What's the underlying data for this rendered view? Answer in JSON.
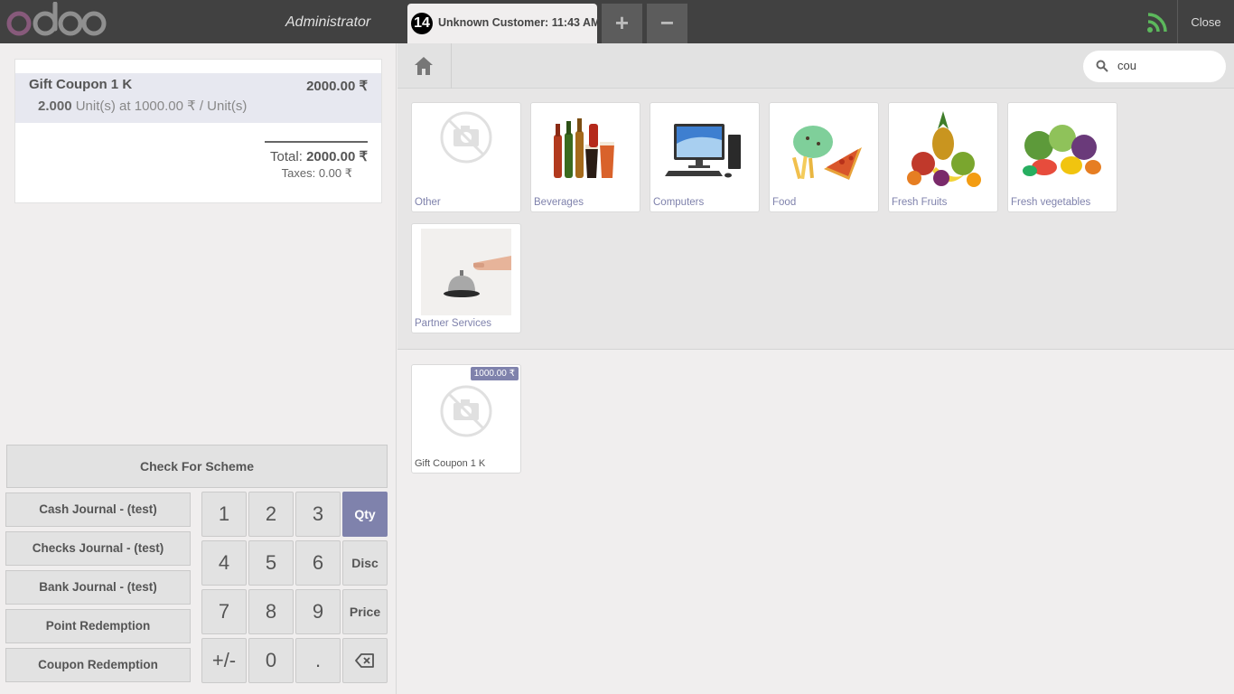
{
  "brand": {
    "name": "odoo"
  },
  "header": {
    "user": "Administrator",
    "order_tab": {
      "number": "14",
      "label": "Unknown Customer: 11:43 AM"
    },
    "add_order_symbol": "+",
    "remove_order_symbol": "−",
    "close_label": "Close",
    "connection_status_icon": "wifi-icon",
    "connection_color": "#5cb85c"
  },
  "order": {
    "lines": [
      {
        "name": "Gift Coupon 1 K",
        "price": "2000.00 ₹",
        "qty": "2.000",
        "unit_info": "Unit(s) at 1000.00 ₹ / Unit(s)"
      }
    ],
    "total_label": "Total:",
    "total_value": "2000.00 ₹",
    "taxes_label": "Taxes:",
    "taxes_value": "0.00 ₹"
  },
  "actions": {
    "scheme_label": "Check For Scheme"
  },
  "payment_methods": [
    "Cash Journal - (test)",
    "Checks Journal - (test)",
    "Bank Journal - (test)",
    "Point Redemption",
    "Coupon Redemption"
  ],
  "numpad": {
    "keys": [
      "1",
      "2",
      "3",
      "4",
      "5",
      "6",
      "7",
      "8",
      "9",
      "+/-",
      "0",
      "."
    ],
    "modes": [
      "Qty",
      "Disc",
      "Price"
    ],
    "active_mode": "Qty",
    "backspace_icon": "backspace-icon"
  },
  "search": {
    "value": "cou"
  },
  "categories": [
    {
      "name": "Other",
      "icon": "no-photo-icon"
    },
    {
      "name": "Beverages",
      "icon": "beverages-image"
    },
    {
      "name": "Computers",
      "icon": "computer-image"
    },
    {
      "name": "Food",
      "icon": "food-image"
    },
    {
      "name": "Fresh Fruits",
      "icon": "fruits-image"
    },
    {
      "name": "Fresh vegetables",
      "icon": "vegetables-image"
    },
    {
      "name": "Partner Services",
      "icon": "service-bell-image"
    }
  ],
  "products": [
    {
      "name": "Gift Coupon 1 K",
      "price": "1000.00 ₹",
      "icon": "no-photo-icon"
    }
  ],
  "colors": {
    "accent": "#7f82ac",
    "topbar": "#414141",
    "brand_purple": "#875a7b",
    "brand_gray": "#8f8f8f"
  }
}
